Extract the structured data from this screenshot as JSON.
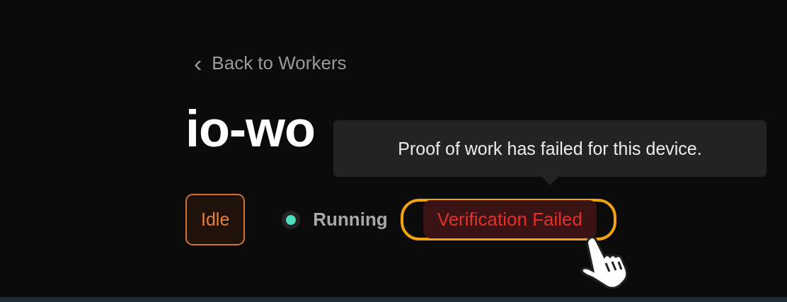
{
  "back_link": {
    "icon": "‹",
    "label": "Back to Workers"
  },
  "title": "io-wo",
  "statuses": [
    {
      "kind": "outlined",
      "label": "Idle",
      "focused": false
    },
    {
      "kind": "dot",
      "label": "Running",
      "color": "#4fe0c0",
      "focused": false
    },
    {
      "kind": "filled",
      "label": "Verification Failed",
      "focused": true
    }
  ],
  "tooltip": {
    "text": "Proof of work has failed for this device."
  }
}
